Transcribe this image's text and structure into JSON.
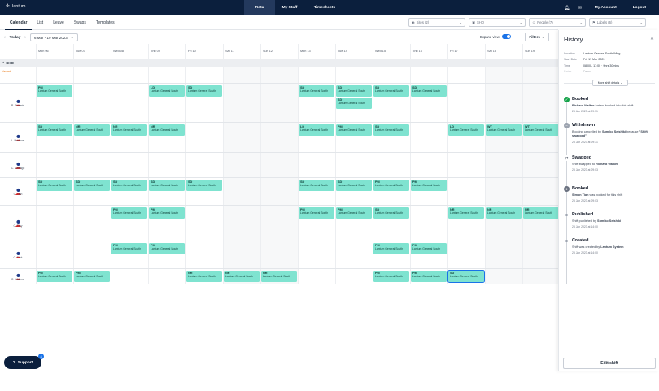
{
  "app": {
    "logo_text": "lantum"
  },
  "nav": {
    "items": [
      {
        "label": "Rota",
        "active": true
      },
      {
        "label": "My Staff"
      },
      {
        "label": "Timesheets"
      }
    ]
  },
  "top_right": {
    "my_account": "My Account",
    "logout": "Logout"
  },
  "subtabs": [
    "Calendar",
    "List",
    "Leave",
    "Swaps",
    "Templates"
  ],
  "filters": [
    {
      "label": "Sites (2)"
    },
    {
      "label": "SHO"
    },
    {
      "label": "People (7)"
    },
    {
      "label": "Labels (6)"
    }
  ],
  "datebar": {
    "today": "Today",
    "range": "6 Mar - 19 Mar 2023",
    "expand_label": "Expand view",
    "filters_label": "Filters"
  },
  "days": [
    "Mon 06",
    "Tue 07",
    "Wed 08",
    "Thu 09",
    "Fri 10",
    "Sat 11",
    "Sun 12",
    "Mon 13",
    "Tue 14",
    "Wed 15",
    "Thu 16",
    "Fri 17",
    "Sat 18",
    "Sun 19"
  ],
  "group": {
    "name": "SHO"
  },
  "vacant_label": "Vacant",
  "employees": [
    {
      "name": "R. Roberts",
      "shifts": [
        {
          "day": 0,
          "code": "PM"
        },
        {
          "day": 3,
          "code": "LD"
        },
        {
          "day": 4,
          "code": "SD"
        },
        {
          "day": 7,
          "code": "SD"
        },
        {
          "day": 8,
          "code": "SD"
        },
        {
          "day": 8,
          "code": "SD",
          "slot": 1
        },
        {
          "day": 9,
          "code": "SD"
        },
        {
          "day": 10,
          "code": "SD"
        }
      ]
    },
    {
      "name": "L. Marlowe",
      "shifts": [
        {
          "day": 0,
          "code": "SD"
        },
        {
          "day": 1,
          "code": "NR"
        },
        {
          "day": 2,
          "code": "NR"
        },
        {
          "day": 3,
          "code": "NR"
        },
        {
          "day": 7,
          "code": "LD"
        },
        {
          "day": 8,
          "code": "PM"
        },
        {
          "day": 9,
          "code": "SD"
        },
        {
          "day": 11,
          "code": "LD"
        },
        {
          "day": 12,
          "code": "WT"
        },
        {
          "day": 13,
          "code": "WT"
        }
      ]
    },
    {
      "name": "C. Sinsago",
      "shifts": []
    },
    {
      "name": "C. Tian",
      "shifts": [
        {
          "day": 0,
          "code": "SD"
        },
        {
          "day": 1,
          "code": "SD"
        },
        {
          "day": 2,
          "code": "SD"
        },
        {
          "day": 3,
          "code": "SD"
        },
        {
          "day": 4,
          "code": "SD"
        },
        {
          "day": 7,
          "code": "SD"
        },
        {
          "day": 8,
          "code": "SD"
        },
        {
          "day": 9,
          "code": "PM"
        },
        {
          "day": 10,
          "code": "PM"
        }
      ]
    },
    {
      "name": "C. Troy",
      "shifts": [
        {
          "day": 2,
          "code": "PM"
        },
        {
          "day": 3,
          "code": "PM"
        },
        {
          "day": 7,
          "code": "PM"
        },
        {
          "day": 8,
          "code": "PM"
        },
        {
          "day": 9,
          "code": "SD"
        },
        {
          "day": 11,
          "code": "NR"
        },
        {
          "day": 12,
          "code": "NR"
        },
        {
          "day": 13,
          "code": "NR"
        }
      ]
    },
    {
      "name": "C. Turk",
      "shifts": [
        {
          "day": 2,
          "code": "PM"
        },
        {
          "day": 3,
          "code": "PM"
        },
        {
          "day": 9,
          "code": "PM"
        },
        {
          "day": 10,
          "code": "PM"
        }
      ]
    },
    {
      "name": "B. Watson",
      "shifts": [
        {
          "day": 0,
          "code": "PM"
        },
        {
          "day": 1,
          "code": "PM"
        },
        {
          "day": 4,
          "code": "NR"
        },
        {
          "day": 5,
          "code": "NR"
        },
        {
          "day": 6,
          "code": "NR"
        },
        {
          "day": 9,
          "code": "PM"
        },
        {
          "day": 10,
          "code": "PM"
        },
        {
          "day": 11,
          "code": "SD",
          "selected": true
        }
      ]
    }
  ],
  "shift_location": "Lantum General South",
  "support": {
    "label": "Support",
    "badge": "4"
  },
  "history": {
    "title": "History",
    "meta": [
      {
        "k": "Location",
        "v": "Lantum General South Wing"
      },
      {
        "k": "Start Date",
        "v": "Fri, 17 Mar 2023"
      },
      {
        "k": "Time",
        "v": "08:00 - 17:00 · 9hrs 30mins"
      },
      {
        "k": "Rates",
        "v": "Demo"
      }
    ],
    "more_label": "More shift details",
    "events": [
      {
        "type": "booked",
        "title": "Booked",
        "desc_bold": "Richard Walker",
        "desc": " instant booked into this shift",
        "ts": "23 Jan 2023 at 09:31"
      },
      {
        "type": "withdrawn",
        "title": "Withdrawn",
        "desc_pre": "Booking cancelled by ",
        "desc_bold": "Sumiko Seishiki",
        "desc": " because ",
        "desc_bold2": "\"Shift swapped\"",
        "ts": "23 Jan 2023 at 09:31"
      },
      {
        "type": "swapped",
        "title": "Swapped",
        "desc_pre": "Shift swapped to ",
        "desc_bold": "Richard Walker",
        "desc": "",
        "ts": "23 Jan 2023 at 09:03"
      },
      {
        "type": "booked",
        "title": "Booked",
        "desc_bold": "Simon Tian",
        "desc": " was booked for this shift",
        "ts": "23 Jan 2023 at 09:03"
      },
      {
        "type": "published",
        "title": "Published",
        "desc_pre": "Shift published by ",
        "desc_bold": "Sumiko Seishiki",
        "desc": "",
        "ts": "23 Jan 2023 at 14:00"
      },
      {
        "type": "created",
        "title": "Created",
        "desc_pre": "Shift was created by ",
        "desc_bold": "Lantum System",
        "desc": "",
        "ts": "23 Jan 2023 at 14:00"
      }
    ],
    "edit_label": "Edit shift"
  }
}
